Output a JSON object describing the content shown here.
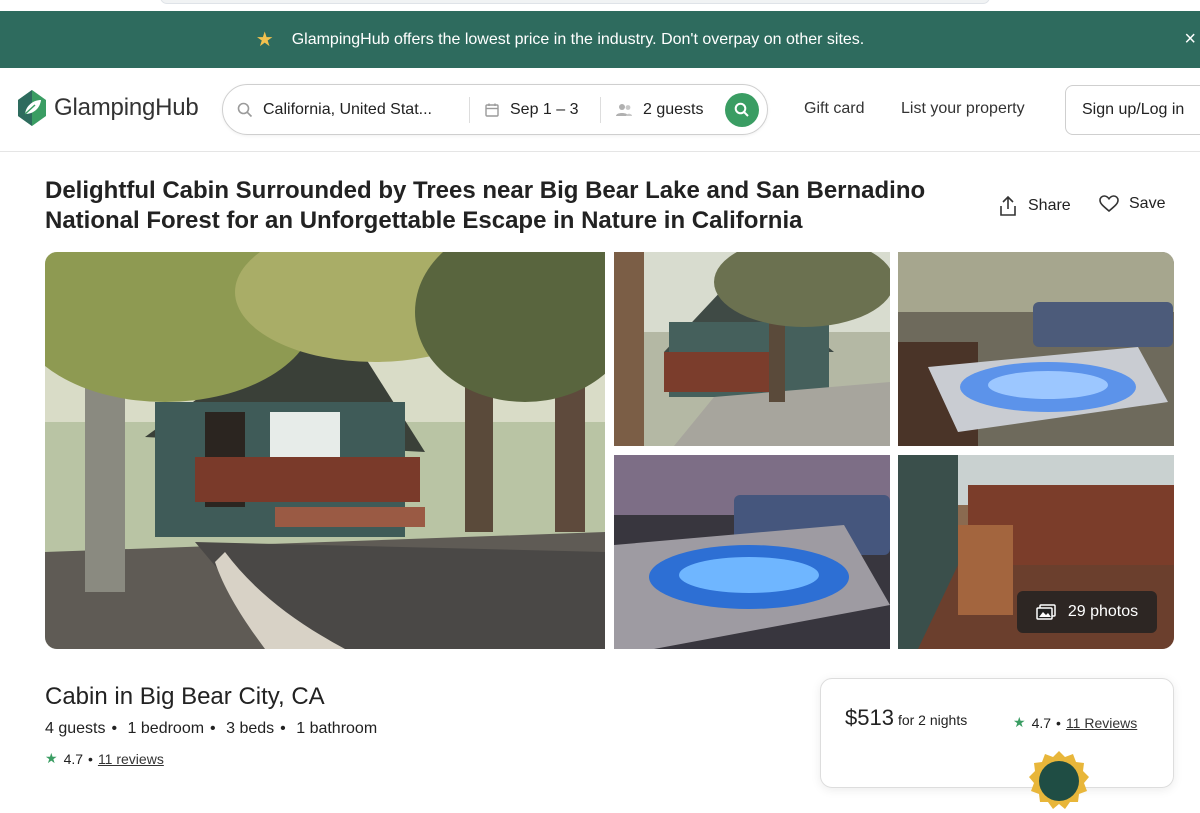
{
  "promo": {
    "text": "GlampingHub offers the lowest price in the industry. Don't overpay on other sites.",
    "close": "×"
  },
  "brand": {
    "name": "GlampingHub"
  },
  "search": {
    "location": "California, United Stat...",
    "dates": "Sep 1 – 3",
    "guests": "2 guests"
  },
  "nav": {
    "gift_card": "Gift card",
    "list_property": "List your property",
    "signup": "Sign up/Log in"
  },
  "listing": {
    "title": "Delightful Cabin Surrounded by Trees near Big Bear Lake and San Bernadino National Forest for an Unforgettable Escape in Nature in California",
    "share": "Share",
    "save": "Save",
    "photos_count": "29 photos",
    "subtitle": "Cabin in Big Bear City, CA",
    "facts": [
      "4 guests",
      "1 bedroom",
      "3 beds",
      "1 bathroom"
    ],
    "rating": "4.7",
    "reviews_link": "11 reviews"
  },
  "booking": {
    "price": "$513",
    "price_note": "for 2 nights",
    "rating": "4.7",
    "reviews_link": "11 Reviews"
  },
  "colors": {
    "brand_green": "#2e6b5e",
    "accent_green": "#3a9d63",
    "promo_star": "#f2c14e"
  },
  "icons": [
    "star-icon",
    "close-icon",
    "logo-leaf-icon",
    "search-icon",
    "calendar-icon",
    "guests-icon",
    "share-icon",
    "heart-icon",
    "photos-icon",
    "badge-icon"
  ]
}
